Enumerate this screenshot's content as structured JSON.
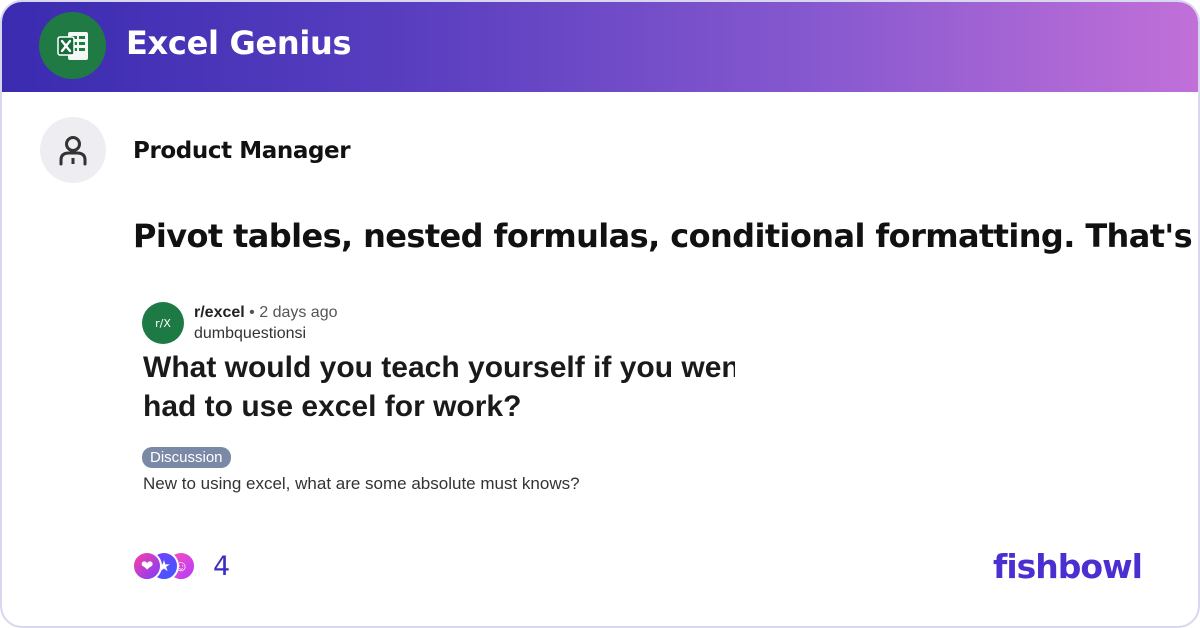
{
  "header": {
    "title": "Excel Genius",
    "logo_icon": "excel-logo-icon",
    "logo_color": "#1f7a44",
    "gradient_start": "#3a2bb0",
    "gradient_end": "#c270d8"
  },
  "post": {
    "author": "Product Manager",
    "author_icon": "user-icon",
    "title": "Pivot tables, nested formulas, conditional formatting. That's my..."
  },
  "embed": {
    "subreddit_icon_text": "r/X",
    "subreddit": "r/excel",
    "time": "• 2 days ago",
    "username": "dumbquestionsi",
    "title_line1": "What would you teach yourself if you went",
    "title_line2": "had to use excel for work?",
    "flair": "Discussion",
    "body": "New to using excel, what are some absolute must knows?"
  },
  "footer": {
    "reaction_count": "4",
    "reaction_icons": [
      "heart-icon",
      "star-icon",
      "laugh-icon"
    ],
    "brand": "fishbowl",
    "brand_color": "#4b2fd0"
  }
}
